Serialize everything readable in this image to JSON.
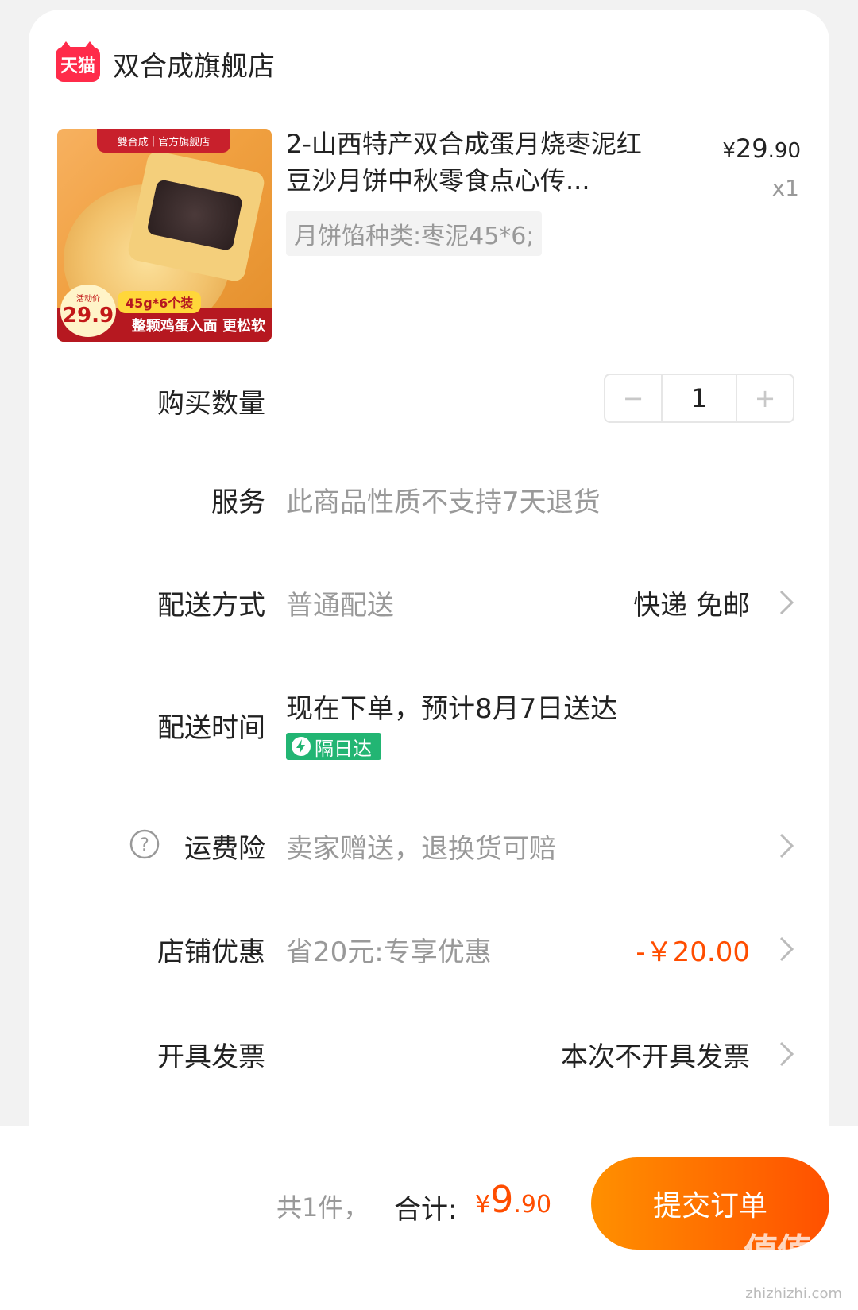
{
  "store": {
    "logo_text": "天猫",
    "name": "双合成旗舰店"
  },
  "product": {
    "title": "2-山西特产双合成蛋月烧枣泥红豆沙月饼中秋零食点心传...",
    "spec": "月饼馅种类:枣泥45*6;",
    "price_currency": "¥",
    "price_int": "29",
    "price_dec": ".90",
    "quantity_label": "x1",
    "image": {
      "brand": "雙合成",
      "official": "官方旗舰店",
      "promo_tag": "45g*6个装",
      "banner": "整颗鸡蛋入面 更松软",
      "price_label": "活动价",
      "price": "29.9"
    }
  },
  "quantity": {
    "label": "购买数量",
    "value": "1",
    "minus": "−",
    "plus": "+"
  },
  "service": {
    "label": "服务",
    "value": "此商品性质不支持7天退货"
  },
  "delivery": {
    "label": "配送方式",
    "value": "普通配送",
    "right": "快递 免邮"
  },
  "delivery_time": {
    "label": "配送时间",
    "value": "现在下单，预计8月7日送达",
    "badge": "隔日达"
  },
  "shipping_insurance": {
    "label": "运费险",
    "value": "卖家赠送，退换货可赔"
  },
  "store_discount": {
    "label": "店铺优惠",
    "value": "省20元:专享优惠",
    "amount": "-￥20.00"
  },
  "invoice": {
    "label": "开具发票",
    "value": "本次不开具发票"
  },
  "footer": {
    "count": "共1件，",
    "total_label": "合计:",
    "total_currency": "¥",
    "total_int": "9",
    "total_dec": ".90",
    "submit": "提交订单",
    "watermark": "值值值",
    "watermark_url": "zhizhizhi.com"
  },
  "colors": {
    "accent": "#ff5000",
    "badge_green": "#22b573",
    "tmall_red": "#ff2b4a"
  }
}
